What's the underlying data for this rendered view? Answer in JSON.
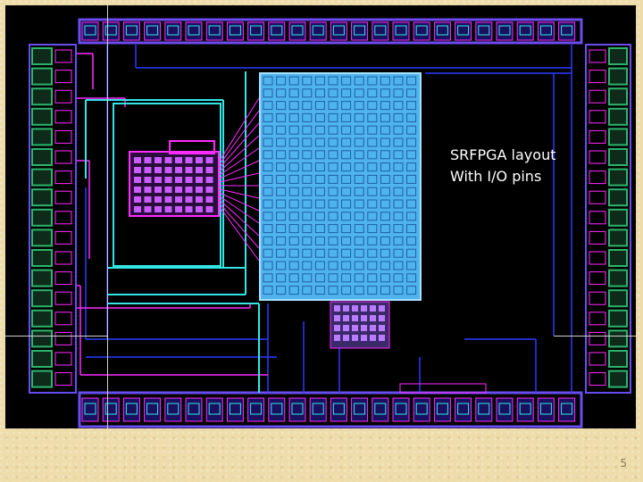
{
  "caption": {
    "line1": "SRFPGA layout",
    "line2": "With I/O pins"
  },
  "slide_number": "5",
  "colors": {
    "background": "#eedcaa",
    "die": "#000000",
    "core_fill": "#4fb4ee",
    "pad_ring": "#6a4cf0",
    "metal_magenta": "#ff2bff",
    "metal_cyan": "#33e6e6",
    "metal_blue": "#2c3aff",
    "io_pad_green": "#2bb56b"
  }
}
